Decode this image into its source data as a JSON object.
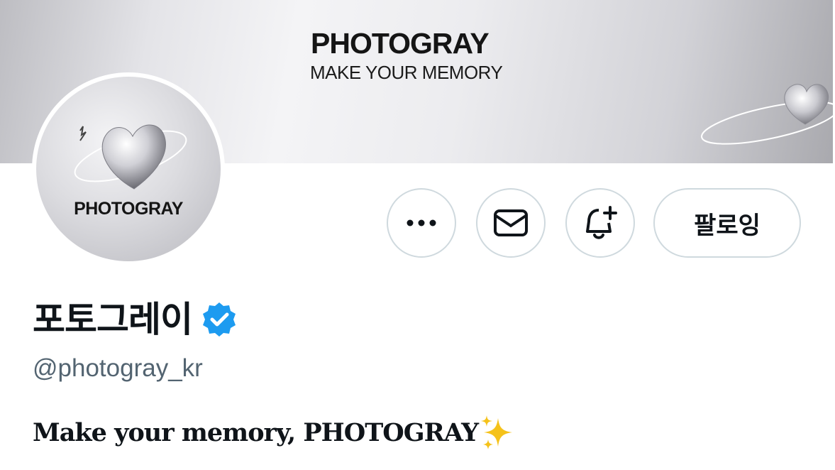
{
  "banner": {
    "title": "PHOTOGRAY",
    "subtitle": "MAKE YOUR MEMORY"
  },
  "avatar": {
    "label": "PHOTOGRAY"
  },
  "actions": {
    "more_icon": "more-horizontal-icon",
    "message_icon": "envelope-icon",
    "notify_icon": "bell-plus-icon",
    "follow_label": "팔로잉"
  },
  "profile": {
    "display_name": "포토그레이",
    "verified": true,
    "handle": "@photogray_kr",
    "bio": "Make your memory, PHOTOGRAY",
    "bio_emoji": "sparkles-icon"
  },
  "colors": {
    "verified_blue": "#1d9bf0",
    "handle_gray": "#536471",
    "border": "#cfd9de",
    "sparkle_gold": "#f5c21a"
  }
}
